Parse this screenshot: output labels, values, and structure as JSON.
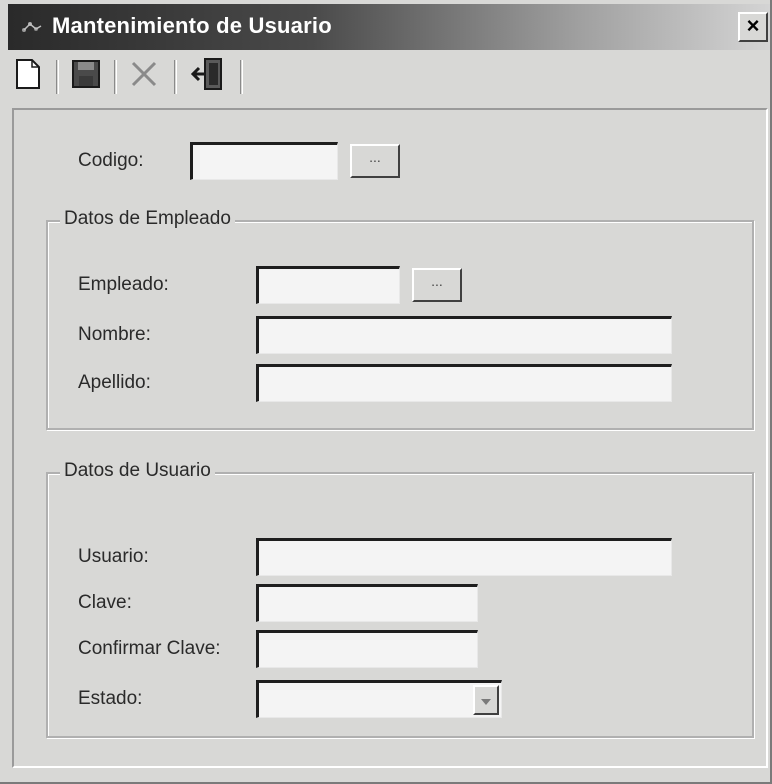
{
  "window": {
    "title": "Mantenimiento de Usuario",
    "close_label": "×"
  },
  "toolbar": {
    "buttons": [
      {
        "icon": "new-document-icon"
      },
      {
        "icon": "save-disk-icon"
      },
      {
        "icon": "delete-x-icon"
      },
      {
        "icon": "exit-door-icon"
      }
    ]
  },
  "form": {
    "codigo": {
      "label": "Codigo:",
      "value": "",
      "lookup_label": "..."
    },
    "empleado_group": {
      "title": "Datos de Empleado",
      "empleado": {
        "label": "Empleado:",
        "value": "",
        "lookup_label": "..."
      },
      "nombre": {
        "label": "Nombre:",
        "value": ""
      },
      "apellido": {
        "label": "Apellido:",
        "value": ""
      }
    },
    "usuario_group": {
      "title": "Datos de Usuario",
      "usuario": {
        "label": "Usuario:",
        "value": ""
      },
      "clave": {
        "label": "Clave:",
        "value": ""
      },
      "confirmar_clave": {
        "label": "Confirmar Clave:",
        "value": ""
      },
      "estado": {
        "label": "Estado:",
        "value": ""
      }
    }
  },
  "colors": {
    "window_bg": "#d8d8d6",
    "title_text": "#ffffff",
    "title_gradient_start": "#2a2a2a"
  }
}
